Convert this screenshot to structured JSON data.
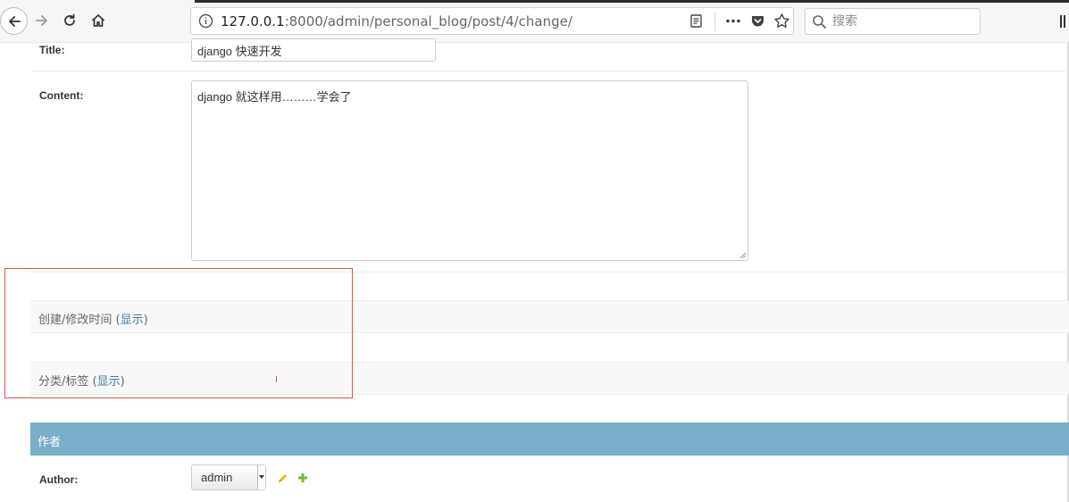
{
  "browser": {
    "url_host": "127.0.0.1",
    "url_rest": ":8000/admin/personal_blog/post/4/change/",
    "search_placeholder": "搜索"
  },
  "form": {
    "title": {
      "label": "Title:",
      "value": "django 快速开发"
    },
    "content": {
      "label": "Content:",
      "value": "django 就这样用………学会了"
    }
  },
  "fieldsets": [
    {
      "title": "创建/修改时间",
      "toggle_label": "显示"
    },
    {
      "title": "分类/标签",
      "toggle_label": "显示"
    }
  ],
  "author_module": {
    "title": "作者",
    "label": "Author:",
    "selected": "admin"
  },
  "colors": {
    "module_header": "#79aec8",
    "link": "#447e9b",
    "annotation": "#d9534f",
    "edit_icon": "#efb80b",
    "add_icon": "#70bf2b"
  }
}
